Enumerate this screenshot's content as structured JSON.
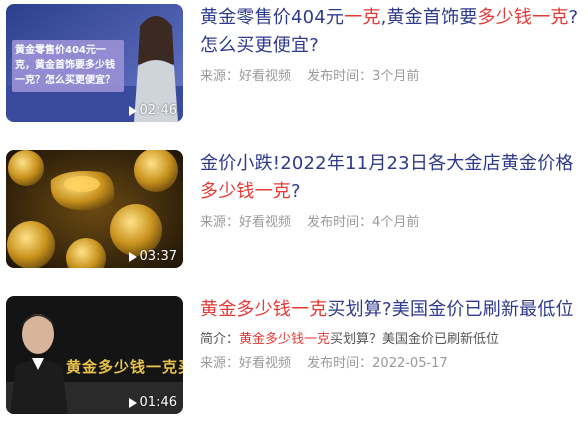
{
  "results": [
    {
      "title_parts": [
        {
          "text": "黄金零售价404元",
          "hl": false
        },
        {
          "text": "一克",
          "hl": true
        },
        {
          "text": ",黄金首饰要",
          "hl": false
        },
        {
          "text": "多少钱一克",
          "hl": true
        },
        {
          "text": "?怎么买更便宜?",
          "hl": false
        }
      ],
      "thumb_caption": "黄金零售价404元一克，黄金首饰要多少钱一克？怎么买更便宜？",
      "duration": "02:46",
      "source": "来源：好看视频",
      "published": "发布时间：3个月前"
    },
    {
      "title_parts": [
        {
          "text": "金价小跌!2022年11月23日各大金店黄金价格",
          "hl": false
        },
        {
          "text": "多少钱一克",
          "hl": true
        },
        {
          "text": "?",
          "hl": false
        }
      ],
      "duration": "03:37",
      "source": "来源：好看视频",
      "published": "发布时间：4个月前"
    },
    {
      "title_parts": [
        {
          "text": "黄金多少钱一克",
          "hl": true
        },
        {
          "text": "买划算?美国金价已刷新最低位",
          "hl": false
        }
      ],
      "desc_label": "简介：",
      "desc_parts": [
        {
          "text": "黄金多少钱一克",
          "hl": true
        },
        {
          "text": "买划算？美国金价已刷新低位",
          "hl": false
        }
      ],
      "thumb_caption": "黄金多少钱一克买合",
      "duration": "01:46",
      "source": "来源：好看视频",
      "published": "发布时间：2022-05-17"
    }
  ]
}
